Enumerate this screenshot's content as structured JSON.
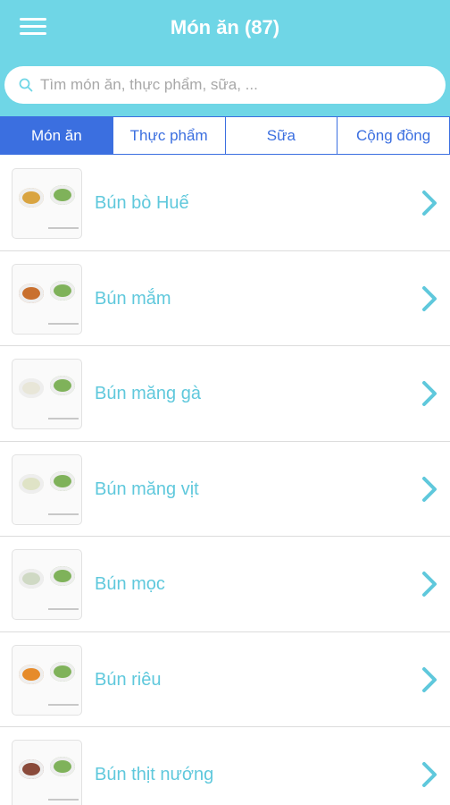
{
  "header": {
    "title": "Món ăn (87)",
    "menu_icon": "hamburger-menu-icon",
    "background_color": "#6fd6e6"
  },
  "search": {
    "placeholder": "Tìm món ăn, thực phẩm, sữa, ...",
    "icon": "search-icon"
  },
  "tabs": [
    {
      "label": "Món ăn",
      "active": true
    },
    {
      "label": "Thực phẩm",
      "active": false
    },
    {
      "label": "Sữa",
      "active": false
    },
    {
      "label": "Cộng đồng",
      "active": false
    }
  ],
  "colors": {
    "tab_accent": "#3b6fe0",
    "item_text": "#5fc8dc",
    "chevron": "#5fc8dc"
  },
  "items": [
    {
      "name": "Bún bò Huế",
      "bowl_color": "#d9a441"
    },
    {
      "name": "Bún mắm",
      "bowl_color": "#c9702e"
    },
    {
      "name": "Bún măng gà",
      "bowl_color": "#e8e6d8"
    },
    {
      "name": "Bún măng vịt",
      "bowl_color": "#dfe3c6"
    },
    {
      "name": "Bún mọc",
      "bowl_color": "#cfd9c4"
    },
    {
      "name": "Bún riêu",
      "bowl_color": "#e68b2a"
    },
    {
      "name": "Bún thịt nướng",
      "bowl_color": "#8a4a3a"
    }
  ]
}
